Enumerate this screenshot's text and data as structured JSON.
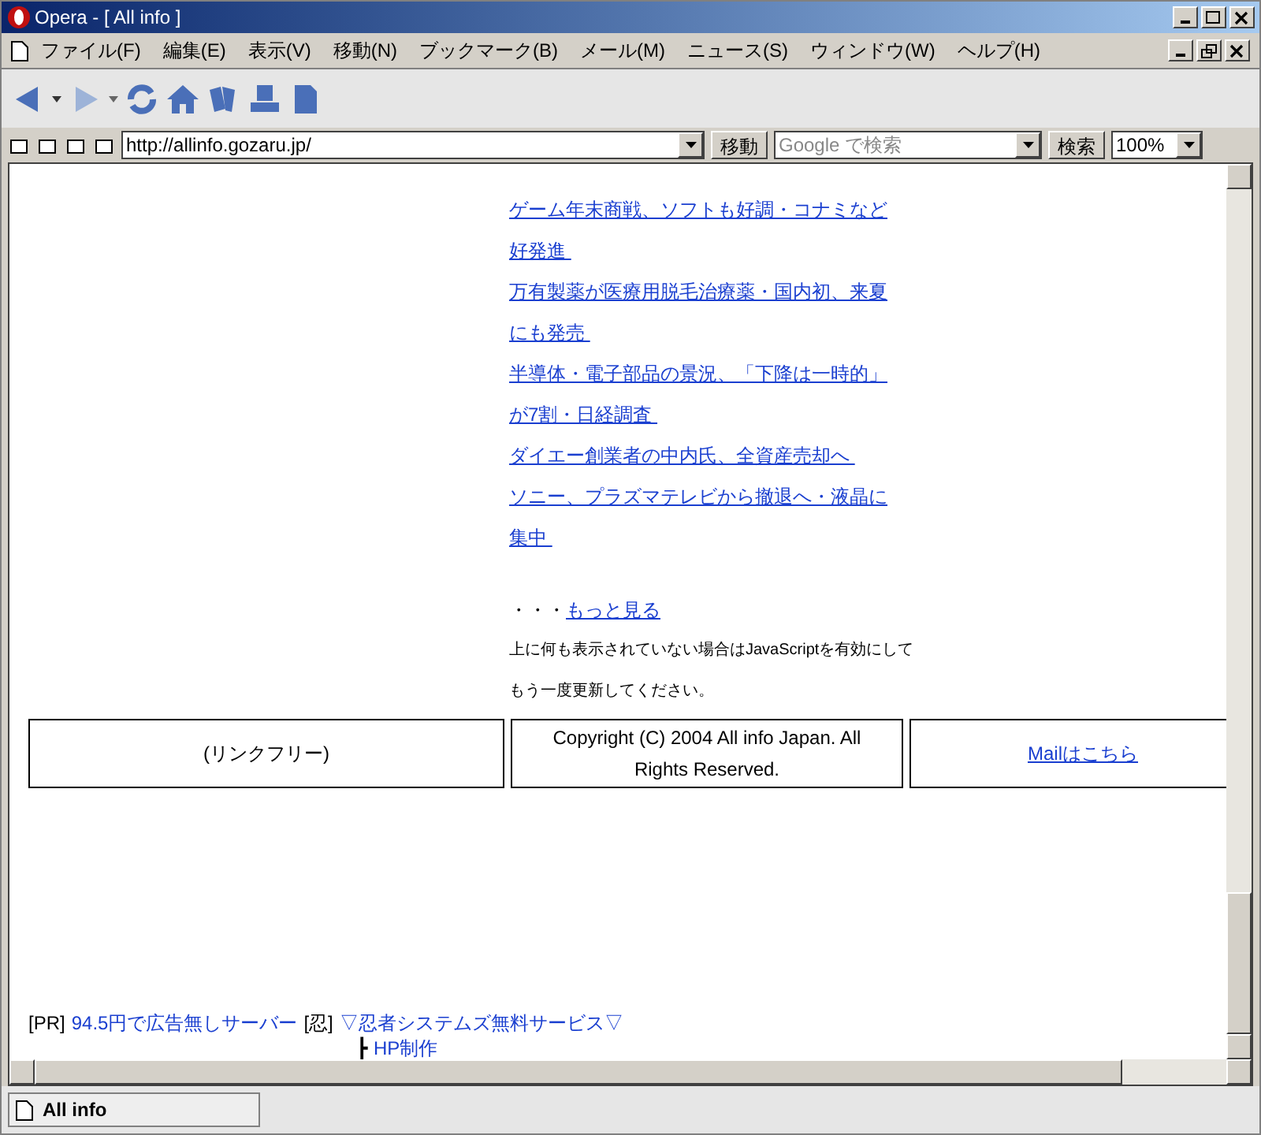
{
  "window": {
    "title": "Opera - [ All info ]"
  },
  "menu": [
    "ファイル(F)",
    "編集(E)",
    "表示(V)",
    "移動(N)",
    "ブックマーク(B)",
    "メール(M)",
    "ニュース(S)",
    "ウィンドウ(W)",
    "ヘルプ(H)"
  ],
  "address_bar": {
    "url": "http://allinfo.gozaru.jp/",
    "go_button": "移動",
    "search_placeholder": "Google で検索",
    "search_button": "検索",
    "zoom": "100%"
  },
  "headlines": [
    {
      "text": "ゲーム年末商戦、ソフトも好調・コナミなど好発進 "
    },
    {
      "text": "万有製薬が医療用脱毛治療薬・国内初、来夏にも発売 "
    },
    {
      "text": "半導体・電子部品の景況、「下降は一時的」が7割・日経調査 "
    },
    {
      "text": "ダイエー創業者の中内氏、全資産売却へ "
    },
    {
      "text": "ソニー、プラズマテレビから撤退へ・液晶に集中 "
    }
  ],
  "more": {
    "prefix": "・・・",
    "link": "もっと見る"
  },
  "notice": [
    "上に何も表示されていない場合はJavaScriptを有効にして",
    "もう一度更新してください。"
  ],
  "footer": [
    {
      "kind": "text",
      "text": "(リンクフリー)"
    },
    {
      "kind": "text",
      "text": "Copyright (C) 2004 All info Japan. All Rights Reserved."
    },
    {
      "kind": "link",
      "text": "Mailはこちら"
    }
  ],
  "ad": {
    "tag": "[PR]",
    "link": "94.5円で広告無しサーバー",
    "tag2": "[忍]",
    "link2": "▽忍者システムズ無料サービス▽",
    "sub_prefix": "┣",
    "sub_link": "HP制作"
  },
  "status_bar": {
    "tab": "All info"
  }
}
